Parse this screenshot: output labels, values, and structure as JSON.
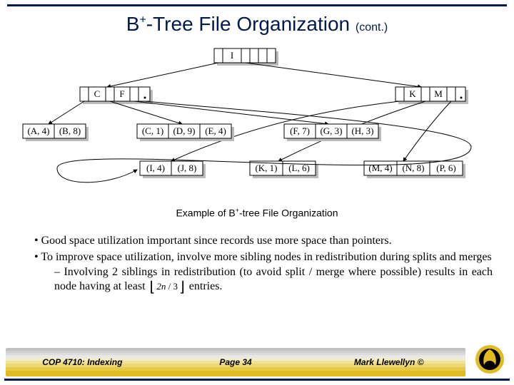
{
  "title": {
    "pre": "B",
    "sup": "+",
    "post": "-Tree File Organization",
    "cont": "(cont.)"
  },
  "caption": {
    "pre": "Example of B",
    "sup": "+",
    "post": "-tree File Organization"
  },
  "bullets": {
    "b1": "Good space utilization important since records use more space than pointers.",
    "b2": "To improve space utilization, involve more sibling nodes in redistribution during splits and merges",
    "b2a_pre": "Involving 2 siblings in redistribution (to avoid split / merge where possible) results in each node having at least",
    "b2a_formula_n": "2n",
    "b2a_formula_d": " / 3",
    "b2a_post": "entries."
  },
  "diagram": {
    "root": "I",
    "mid_left_k1": "C",
    "mid_left_k2": "F",
    "mid_right_k1": "K",
    "mid_right_k2": "M",
    "leaves": {
      "l1a": "(A, 4)",
      "l1b": "(B, 8)",
      "l2a": "(C, 1)",
      "l2b": "(D, 9)",
      "l2c": "(E, 4)",
      "l3a": "(F, 7)",
      "l3b": "(G, 3)",
      "l3c": "(H, 3)",
      "l4a": "(I, 4)",
      "l4b": "(J, 8)",
      "l5a": "(K, 1)",
      "l5b": "(L, 6)",
      "l6a": "(M, 4)",
      "l6b": "(N, 8)",
      "l6c": "(P, 6)"
    }
  },
  "footer": {
    "left": "COP 4710: Indexing",
    "center": "Page 34",
    "right": "Mark Llewellyn ©"
  }
}
